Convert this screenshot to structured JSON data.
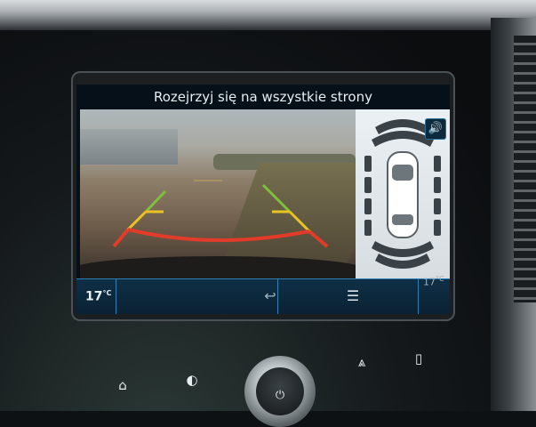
{
  "banner": {
    "text": "Rozejrzyj się na wszystkie strony"
  },
  "status": {
    "temp_left": "17",
    "temp_left_unit": "°C",
    "temp_right": "17",
    "temp_right_unit": "°C"
  },
  "icons": {
    "sound": "speaker-icon",
    "back": "back-arrow-icon",
    "list": "list-icon",
    "home": "home-icon",
    "display": "brightness-icon",
    "hazard": "driver-assist-icon",
    "phone": "phone-icon",
    "power": "power-icon"
  },
  "glyphs": {
    "sound": "🔊",
    "back": "↩",
    "list": "☰",
    "home": "⌂",
    "display": "◐",
    "hazard": "⩓",
    "phone": "▯",
    "power": "⏻"
  },
  "colors": {
    "guide_red": "#e23b2a",
    "guide_yellow": "#e7c324",
    "guide_green": "#7fbf3b",
    "accent": "#2f7fb3"
  }
}
